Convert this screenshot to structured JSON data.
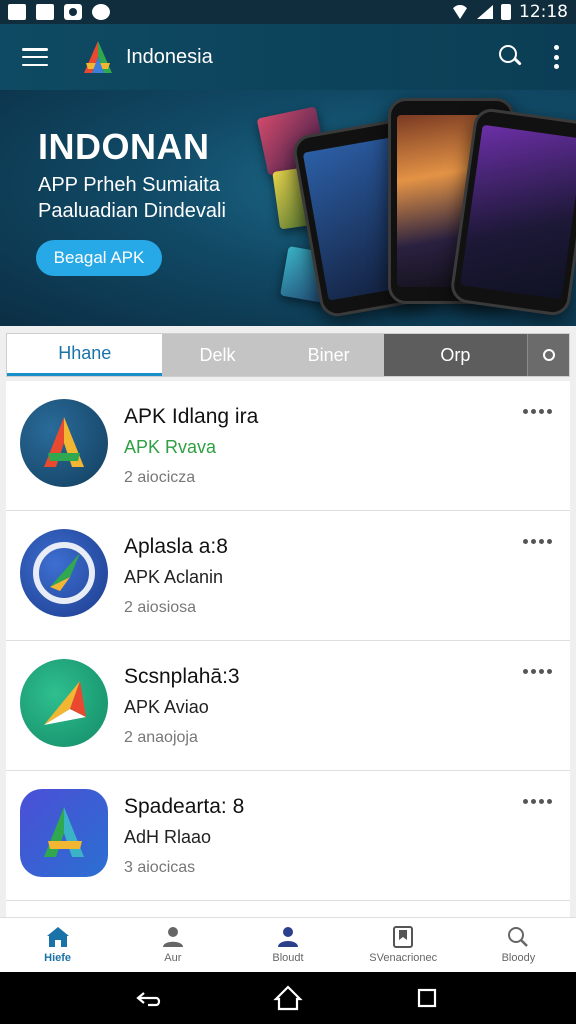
{
  "status_bar": {
    "time": "12:18"
  },
  "app_bar": {
    "title": "Indonesia"
  },
  "banner": {
    "title": "INDONAN",
    "subtitle_line1": "APP Prheh Sumiaita",
    "subtitle_line2": "Paaluadian Dindevali",
    "button_label": "Beagal APK"
  },
  "tabs": [
    {
      "label": "Hhane"
    },
    {
      "label": "Delk"
    },
    {
      "label": "Biner"
    },
    {
      "label": "Orp"
    }
  ],
  "apps": [
    {
      "name": "APK Idlang ira",
      "subtitle": "APK Rvava",
      "meta": "2 aiocicza"
    },
    {
      "name": "Aplasla a:8",
      "subtitle": "APK Aclanin",
      "meta": "2 aiosiosa"
    },
    {
      "name": "Scsnplahā:3",
      "subtitle": "APK Aviao",
      "meta": "2 anaojoja"
    },
    {
      "name": "Spadearta: 8",
      "subtitle": "AdH Rlaao",
      "meta": "3 aiocicas"
    }
  ],
  "bottom_nav": [
    {
      "label": "Hiefe",
      "icon": "home-icon"
    },
    {
      "label": "Aur",
      "icon": "person-icon"
    },
    {
      "label": "Bloudt",
      "icon": "people-icon"
    },
    {
      "label": "SVenacrionec",
      "icon": "bookmark-icon"
    },
    {
      "label": "Bloody",
      "icon": "search-icon"
    }
  ],
  "colors": {
    "app_bar": "#0e4a63",
    "accent": "#1a8ec8",
    "button": "#27a9e8"
  }
}
